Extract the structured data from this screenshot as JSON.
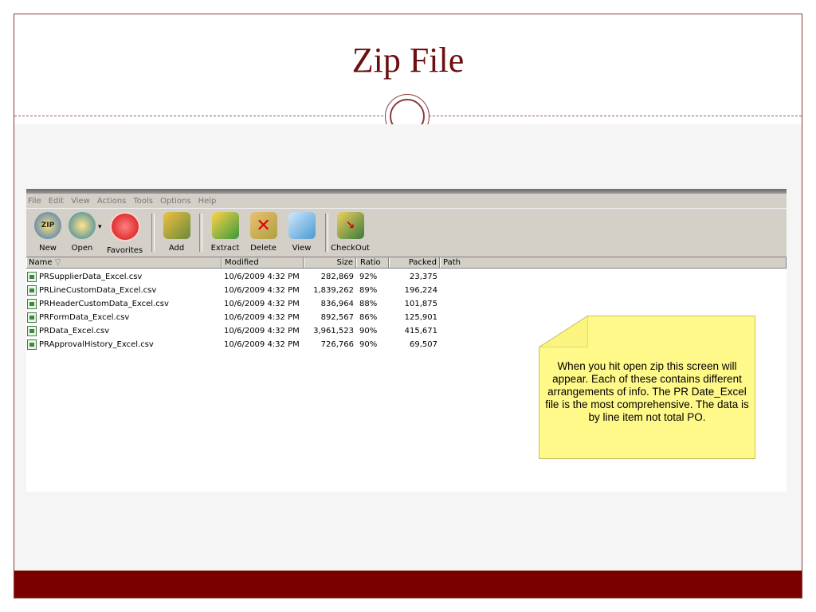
{
  "slide": {
    "title": "Zip File"
  },
  "app": {
    "menu": [
      "File",
      "Edit",
      "View",
      "Actions",
      "Tools",
      "Options",
      "Help"
    ],
    "toolbar": [
      {
        "label": "New",
        "icon": "winzip-new-icon"
      },
      {
        "label": "Open",
        "icon": "folder-open-icon"
      },
      {
        "label": "Favorites",
        "icon": "heart-favorites-icon"
      },
      {
        "label": "Add",
        "icon": "add-archive-icon"
      },
      {
        "label": "Extract",
        "icon": "extract-folder-icon"
      },
      {
        "label": "Delete",
        "icon": "delete-x-icon"
      },
      {
        "label": "View",
        "icon": "view-glasses-icon"
      },
      {
        "label": "CheckOut",
        "icon": "checkout-icon"
      }
    ],
    "columns": {
      "name": "Name",
      "modified": "Modified",
      "size": "Size",
      "ratio": "Ratio",
      "packed": "Packed",
      "path": "Path"
    },
    "files": [
      {
        "name": "PRSupplierData_Excel.csv",
        "modified": "10/6/2009 4:32 PM",
        "size": "282,869",
        "ratio": "92%",
        "packed": "23,375"
      },
      {
        "name": "PRLineCustomData_Excel.csv",
        "modified": "10/6/2009 4:32 PM",
        "size": "1,839,262",
        "ratio": "89%",
        "packed": "196,224"
      },
      {
        "name": "PRHeaderCustomData_Excel.csv",
        "modified": "10/6/2009 4:32 PM",
        "size": "836,964",
        "ratio": "88%",
        "packed": "101,875"
      },
      {
        "name": "PRFormData_Excel.csv",
        "modified": "10/6/2009 4:32 PM",
        "size": "892,567",
        "ratio": "86%",
        "packed": "125,901"
      },
      {
        "name": "PRData_Excel.csv",
        "modified": "10/6/2009 4:32 PM",
        "size": "3,961,523",
        "ratio": "90%",
        "packed": "415,671"
      },
      {
        "name": "PRApprovalHistory_Excel.csv",
        "modified": "10/6/2009 4:32 PM",
        "size": "726,766",
        "ratio": "90%",
        "packed": "69,507"
      }
    ]
  },
  "note": {
    "text": "When you hit open zip this screen will appear.  Each of these contains different arrangements of info.  The PR Date_Excel file is the most comprehensive.  The data is by line item not total PO."
  },
  "colors": {
    "title": "#6d0f12",
    "footer": "#7a0000",
    "note": "#fff98a"
  }
}
